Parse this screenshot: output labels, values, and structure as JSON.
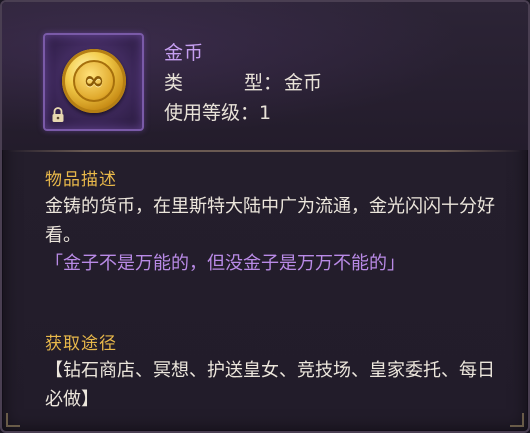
{
  "item": {
    "name": "金币",
    "type_label_1": "类",
    "type_label_2": "型：",
    "type_value": "金币",
    "level_label": "使用等级：",
    "level_value": "1",
    "icon": "gold-coin-icon",
    "locked": true
  },
  "description": {
    "title": "物品描述",
    "text": "金铸的货币，在里斯特大陆中广为流通，金光闪闪十分好看。",
    "quote": "「金子不是万能的，但没金子是万万不能的」"
  },
  "source": {
    "title": "获取途径",
    "text": "【钻石商店、冥想、护送皇女、竞技场、皇家委托、每日必做】"
  },
  "colors": {
    "item_name": "#c59ef0",
    "section_title": "#e8b84a",
    "quote": "#b98ae6",
    "body": "#ece6dc",
    "frame_border": "#7a5aa8"
  }
}
